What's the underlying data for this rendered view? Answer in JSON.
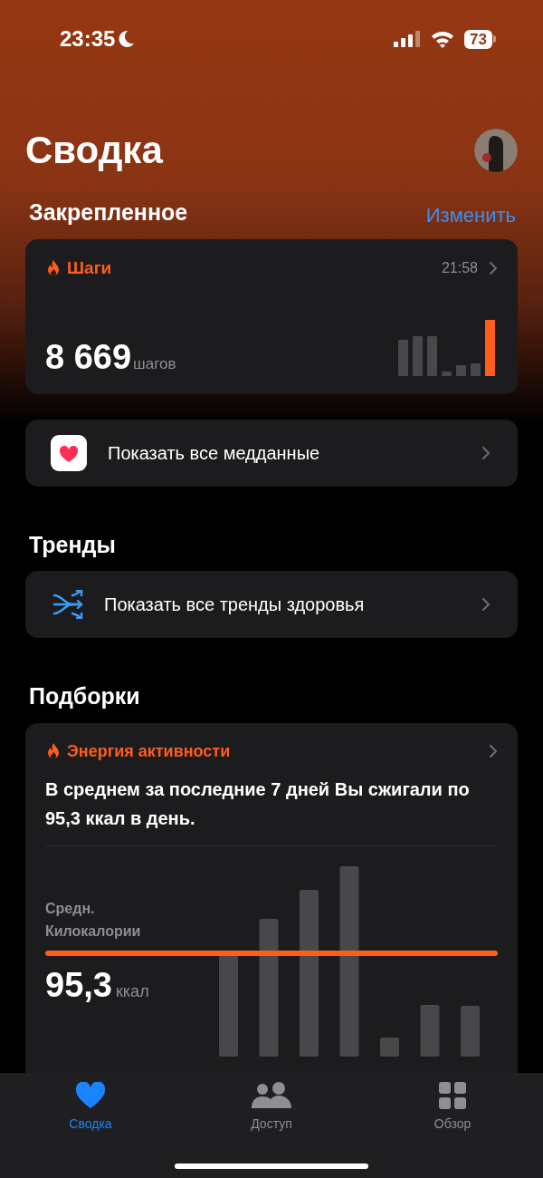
{
  "status_bar": {
    "time": "23:35",
    "battery": "73"
  },
  "header": {
    "title": "Сводка"
  },
  "pinned": {
    "title": "Закрепленное",
    "edit": "Изменить",
    "card": {
      "title": "Шаги",
      "time": "21:58",
      "value": "8 669",
      "unit": "шагов"
    }
  },
  "all_data": {
    "label": "Показать все медданные"
  },
  "trends": {
    "title": "Тренды",
    "label": "Показать все тренды здоровья"
  },
  "highlights": {
    "title": "Подборки",
    "card": {
      "title": "Энергия активности",
      "text": "В среднем за последние 7 дней Вы сжигали по 95,3 ккал в день.",
      "caption_1": "Средн.",
      "caption_2": "Килокалории",
      "value": "95,3",
      "unit": "ккал"
    }
  },
  "tab_bar": [
    {
      "kind": "heart",
      "label": "Сводка",
      "selected": true
    },
    {
      "kind": "people",
      "label": "Доступ",
      "selected": false
    },
    {
      "kind": "grid",
      "label": "Обзор",
      "selected": false
    }
  ]
}
